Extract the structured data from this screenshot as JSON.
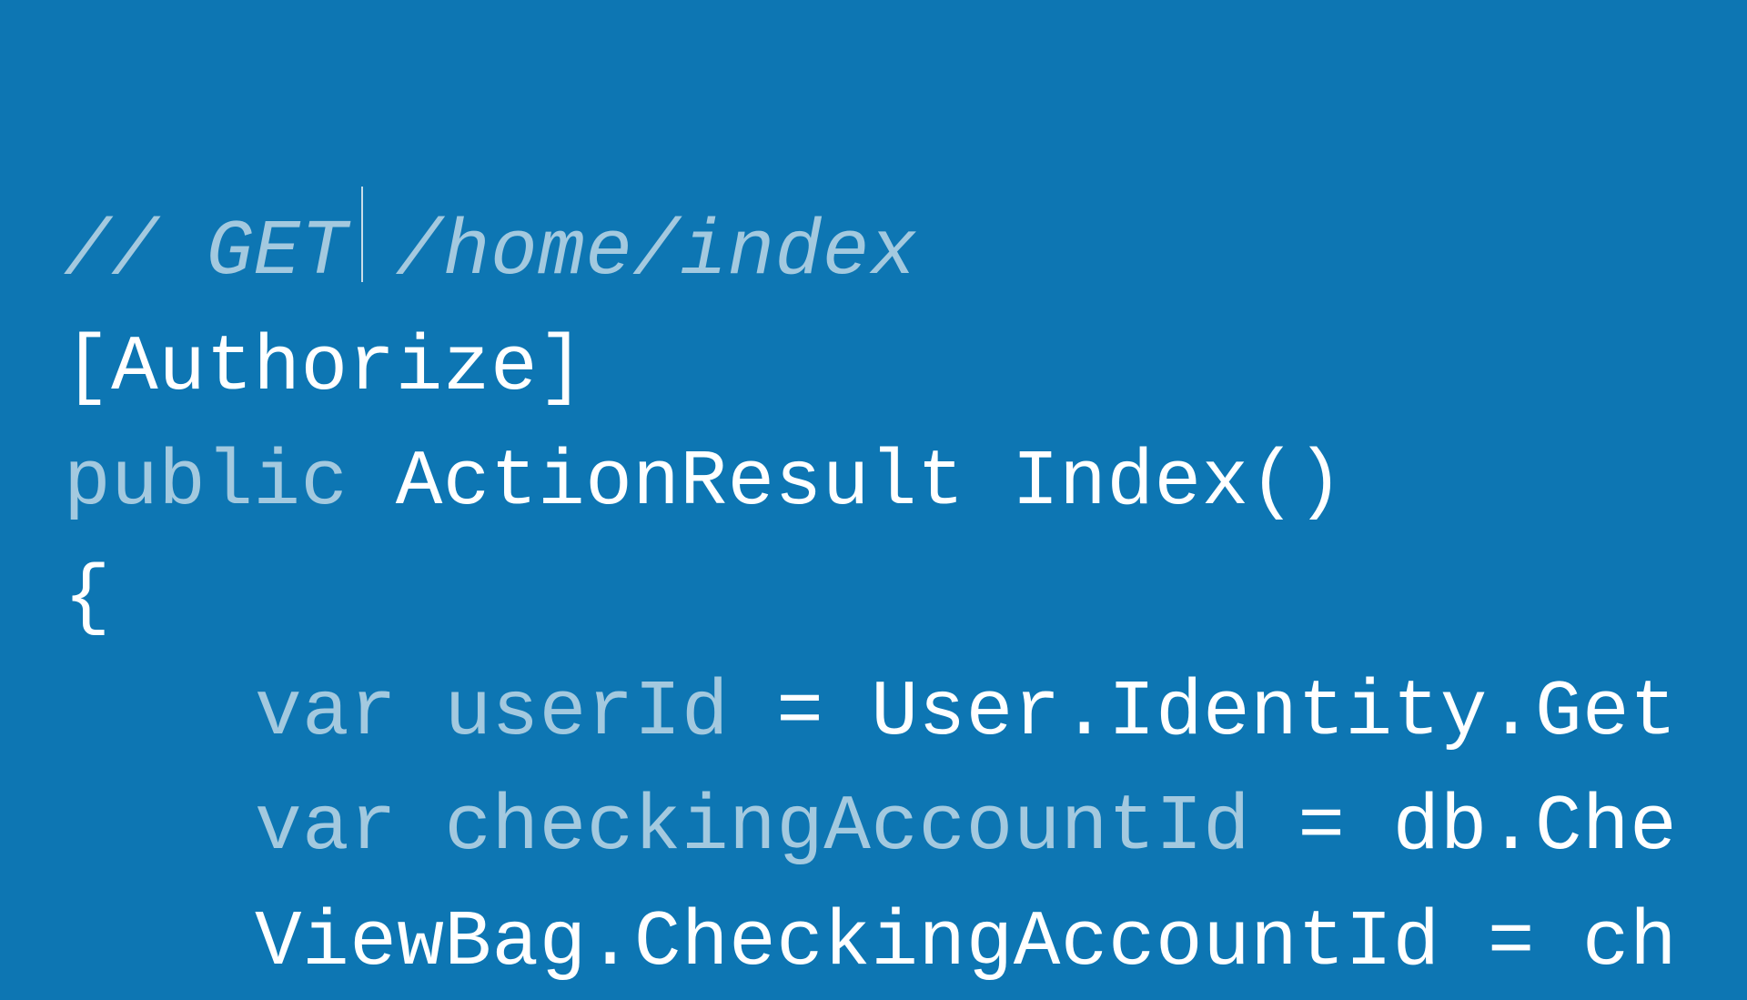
{
  "code": {
    "comment": "// GET /home/index",
    "attribute": "[Authorize]",
    "public_keyword": "public",
    "space1": " ",
    "return_type": "ActionResult",
    "space2": " ",
    "method_name": "Index()",
    "open_brace": "{",
    "var1_keyword": "var",
    "var1_space": " ",
    "var1_name": "userId",
    "var1_assign": " = ",
    "var1_value": "User.Identity.Get",
    "var2_keyword": "var",
    "var2_space": " ",
    "var2_name": "checkingAccountId",
    "var2_assign": " = ",
    "var2_value": "db.Che",
    "line3": "ViewBag.CheckingAccountId = ch"
  }
}
